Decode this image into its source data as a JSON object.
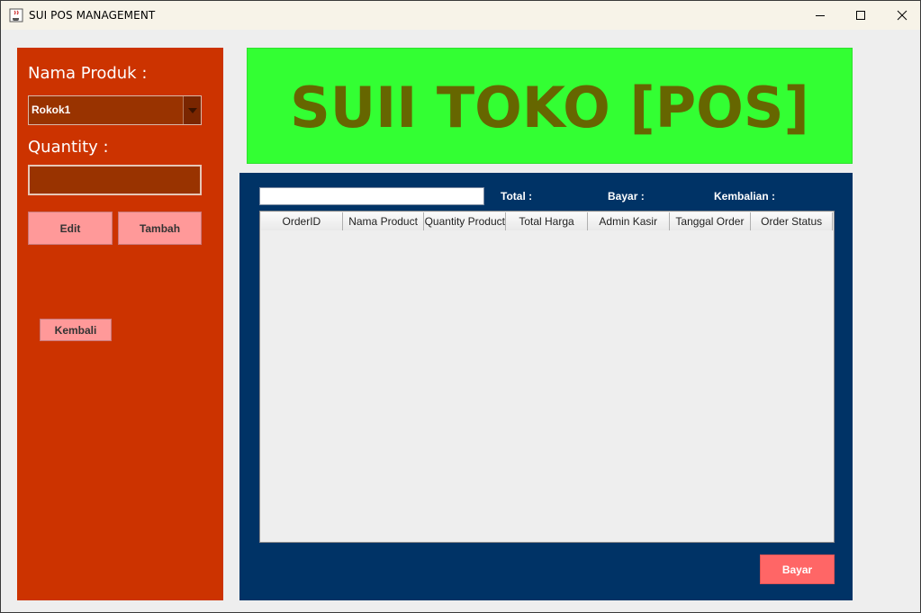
{
  "window": {
    "title": "SUI POS MANAGEMENT",
    "icon": "java-cup-icon"
  },
  "left_panel": {
    "nama_produk_label": "Nama Produk :",
    "product_select": {
      "selected": "Rokok1"
    },
    "quantity_label": "Quantity :",
    "quantity_value": "",
    "edit_label": "Edit",
    "tambah_label": "Tambah",
    "kembali_label": "Kembali"
  },
  "banner": {
    "title": "SUII TOKO [POS]"
  },
  "main": {
    "search_value": "",
    "total_label": "Total :",
    "bayar_label": "Bayar :",
    "kembalian_label": "Kembalian :",
    "table": {
      "columns": [
        "OrderID",
        "Nama Product",
        "Quantity Product",
        "Total Harga",
        "Admin Kasir",
        "Tanggal Order",
        "Order Status"
      ],
      "rows": []
    },
    "bayar_button": "Bayar"
  },
  "colors": {
    "left_panel": "#cc3300",
    "banner_bg": "#33ff33",
    "banner_text": "#666600",
    "main_panel": "#003366",
    "pink_button": "#ff9999",
    "bayar_button": "#ff6666"
  }
}
